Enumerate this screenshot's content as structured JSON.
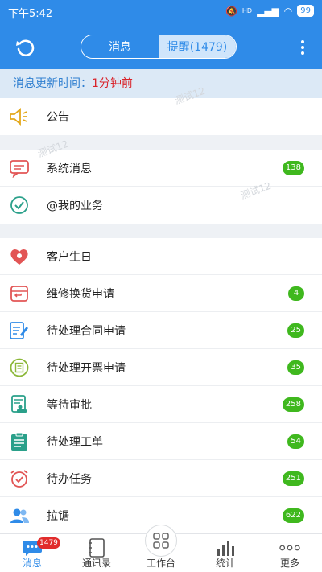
{
  "status_bar": {
    "time": "下午5:42",
    "signal": "HD",
    "battery": "99"
  },
  "header": {
    "segments": [
      {
        "label": "消息"
      },
      {
        "label": "提醒(1479)"
      }
    ]
  },
  "update_bar": {
    "label": "消息更新时间：",
    "value": "1分钟前"
  },
  "groups": [
    {
      "items": [
        {
          "label": "公告",
          "icon": "megaphone-icon",
          "color": "#e3a81b"
        }
      ]
    },
    {
      "items": [
        {
          "label": "系统消息",
          "icon": "chat-bubble-icon",
          "color": "#e25555",
          "badge": "138"
        },
        {
          "label": "@我的业务",
          "icon": "check-circle-icon",
          "color": "#2aa08a"
        }
      ]
    },
    {
      "items": [
        {
          "label": "客户生日",
          "icon": "heart-icon",
          "color": "#e25555"
        },
        {
          "label": "维修换货申请",
          "icon": "return-box-icon",
          "color": "#e25555",
          "badge": "4"
        },
        {
          "label": "待处理合同申请",
          "icon": "contract-edit-icon",
          "color": "#2f8be8",
          "badge": "25"
        },
        {
          "label": "待处理开票申请",
          "icon": "invoice-icon",
          "color": "#8cb83a",
          "badge": "35"
        },
        {
          "label": "等待审批",
          "icon": "approval-doc-icon",
          "color": "#2aa08a",
          "badge": "258"
        },
        {
          "label": "待处理工单",
          "icon": "clipboard-icon",
          "color": "#2aa08a",
          "badge": "54"
        },
        {
          "label": "待办任务",
          "icon": "alarm-clock-icon",
          "color": "#e25555",
          "badge": "251"
        },
        {
          "label": "拉锯",
          "icon": "users-icon",
          "color": "#2f8be8",
          "badge": "622"
        }
      ]
    }
  ],
  "watermark": "测试12",
  "tabs": [
    {
      "label": "消息",
      "badge": "1479",
      "icon": "message-tab-icon"
    },
    {
      "label": "通讯录",
      "icon": "contacts-book-icon"
    },
    {
      "label": "工作台",
      "icon": "grid-icon"
    },
    {
      "label": "统计",
      "icon": "bar-chart-icon"
    },
    {
      "label": "更多",
      "icon": "dots-icon"
    }
  ],
  "colors": {
    "primary": "#2f8be8",
    "badge_green": "#3fb81e",
    "badge_red": "#e12c2c",
    "update_text": "#d9242b"
  }
}
